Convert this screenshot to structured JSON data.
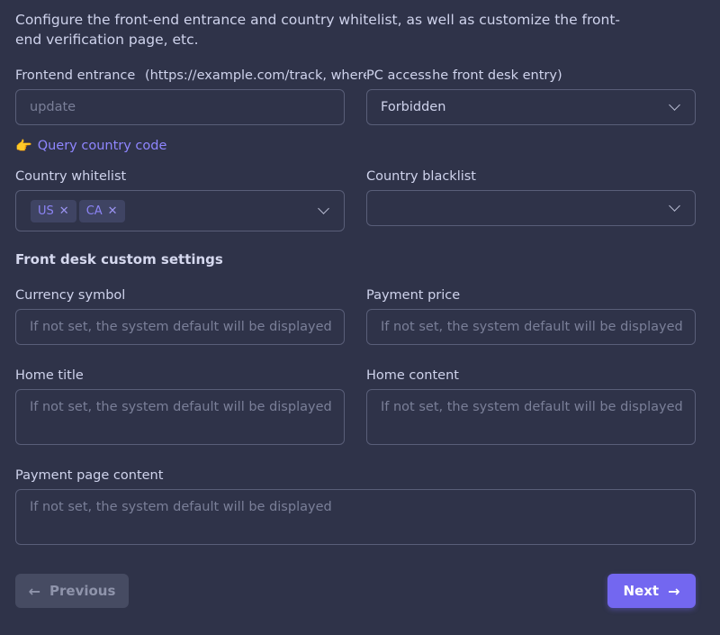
{
  "intro": "Configure the front-end entrance and country whitelist, as well as customize the front-end verification page, etc.",
  "frontend_entrance": {
    "label": "Frontend entrance",
    "hint": "(https://example.com/track, where track is the front desk entry)",
    "placeholder": "update"
  },
  "pc_setting": {
    "label": "PC access",
    "value": "Forbidden"
  },
  "query_link": {
    "icon": "pointing-hand-icon",
    "label": "Query country code"
  },
  "country_whitelist": {
    "label": "Country whitelist",
    "tags": [
      "US",
      "CA"
    ]
  },
  "country_blacklist": {
    "label": "Country blacklist",
    "value": ""
  },
  "section_title": "Front desk custom settings",
  "currency_symbol": {
    "label": "Currency symbol",
    "placeholder": "If not set, the system default will be displayed"
  },
  "payment_price": {
    "label": "Payment price",
    "placeholder": "If not set, the system default will be displayed"
  },
  "home_title": {
    "label": "Home title",
    "placeholder": "If not set, the system default will be displayed"
  },
  "home_content": {
    "label": "Home content",
    "placeholder": "If not set, the system default will be displayed"
  },
  "payment_page_content": {
    "label": "Payment page content",
    "placeholder": "If not set, the system default will be displayed"
  },
  "buttons": {
    "previous": "Previous",
    "next": "Next"
  },
  "colors": {
    "background": "#2f3349",
    "accent": "#7367f0",
    "border": "#595e78"
  }
}
